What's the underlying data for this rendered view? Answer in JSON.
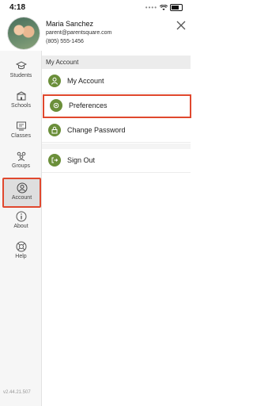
{
  "status": {
    "time": "4:18"
  },
  "user": {
    "name": "Maria Sanchez",
    "email": "parent@parentsquare.com",
    "phone": "(805) 555-1456"
  },
  "sidebar": {
    "items": [
      {
        "label": "Students",
        "icon": "graduation-cap-icon"
      },
      {
        "label": "Schools",
        "icon": "school-icon"
      },
      {
        "label": "Classes",
        "icon": "classes-icon"
      },
      {
        "label": "Groups",
        "icon": "groups-icon"
      },
      {
        "label": "Account",
        "icon": "user-circle-icon",
        "active": true
      },
      {
        "label": "About",
        "icon": "info-icon"
      },
      {
        "label": "Help",
        "icon": "help-lifebuoy-icon"
      }
    ],
    "version": "v2.44.21.507"
  },
  "main": {
    "section_title": "My Account",
    "rows": [
      {
        "label": "My Account",
        "icon": "user-icon"
      },
      {
        "label": "Preferences",
        "icon": "gear-icon",
        "selected": true
      },
      {
        "label": "Change Password",
        "icon": "lock-icon"
      },
      {
        "label": "Sign Out",
        "icon": "sign-out-icon"
      }
    ]
  },
  "colors": {
    "accent": "#6b8f3a",
    "highlight": "#e0482e"
  }
}
